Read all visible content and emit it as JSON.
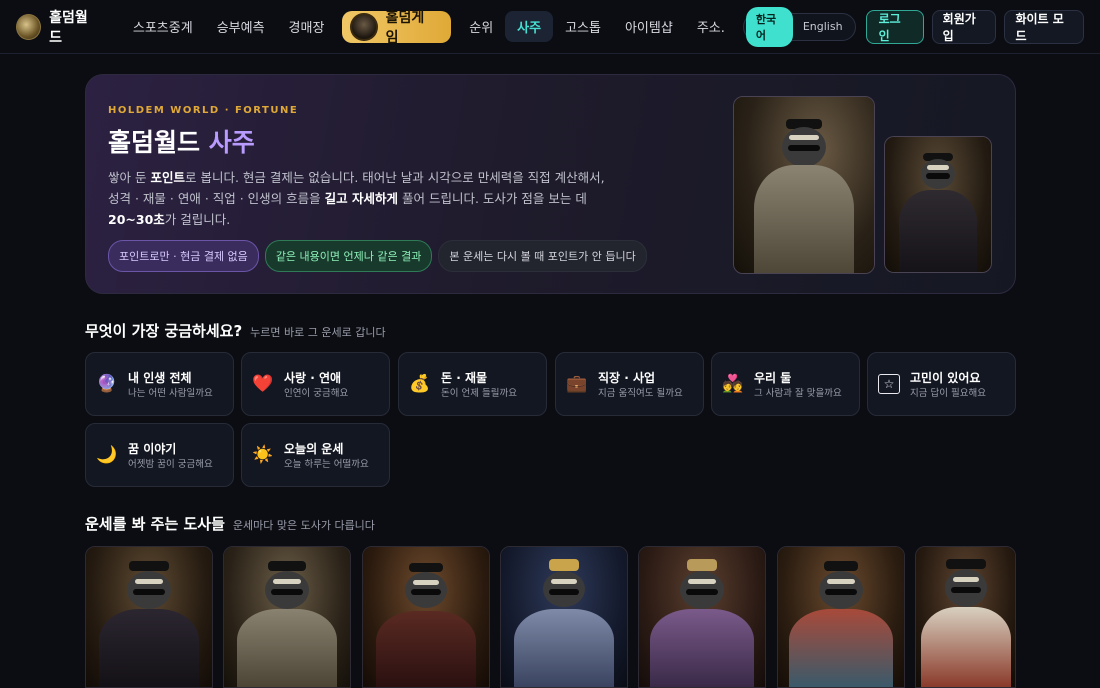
{
  "nav": {
    "brand": "홀덤월드",
    "items": [
      "스포츠중계",
      "승부예측",
      "경매장"
    ],
    "holdem_game": "홀덤게임",
    "items_right": [
      "순위",
      "사주",
      "고스톱",
      "아이템샵",
      "주소."
    ],
    "active": "사주",
    "lang": {
      "ko": "한국어",
      "en": "English"
    },
    "login": "로그인",
    "signup": "회원가입",
    "white_mode": "화이트 모드"
  },
  "hero": {
    "kicker": "HOLDEM WORLD · FORTUNE",
    "title_main": "홀덤월드",
    "title_accent": "사주",
    "desc": {
      "l1_a": "쌓아 둔 ",
      "l1_b": "포인트",
      "l1_c": "로 봅니다. 현금 결제는 없습니다. 태어난 날과 시각으로 만세력을 직접 계산해서,",
      "l2_a": "성격 · 재물 · 연애 · 직업 · 인생의 흐름을 ",
      "l2_b": "길고 자세하게",
      "l2_c": " 풀어 드립니다. 도사가 점을 보는 데",
      "l3_a": "20~30초",
      "l3_b": "가 걸립니다."
    },
    "pills": [
      "포인트로만 · 현금 결제 없음",
      "같은 내용이면 언제나 같은 결과",
      "본 운세는 다시 볼 때 포인트가 안 듭니다"
    ]
  },
  "categories_section": {
    "title": "무엇이 가장 궁금하세요?",
    "sub": "누르면 바로 그 운세로 갑니다",
    "items": [
      {
        "icon": "🔮",
        "icon_name": "crystal-ball-icon",
        "title": "내 인생 전체",
        "sub": "나는 어떤 사람일까요"
      },
      {
        "icon": "❤️",
        "icon_name": "heart-icon",
        "title": "사랑 · 연애",
        "sub": "인연이 궁금해요"
      },
      {
        "icon": "💰",
        "icon_name": "money-bag-icon",
        "title": "돈 · 재물",
        "sub": "돈이 언제 들릴까요"
      },
      {
        "icon": "💼",
        "icon_name": "briefcase-icon",
        "title": "직장 · 사업",
        "sub": "지금 움직여도 될까요"
      },
      {
        "icon": "💑",
        "icon_name": "couple-icon",
        "title": "우리 둘",
        "sub": "그 사람과 잘 맞을까요"
      },
      {
        "icon": "☆",
        "icon_name": "star-box-icon",
        "title": "고민이 있어요",
        "sub": "지금 답이 필요해요"
      },
      {
        "icon": "🌙",
        "icon_name": "crescent-moon-icon",
        "title": "꿈 이야기",
        "sub": "어젯밤 꿈이 궁금해요"
      },
      {
        "icon": "☀️",
        "icon_name": "sun-icon",
        "title": "오늘의 운세",
        "sub": "오늘 하루는 어떨까요"
      }
    ]
  },
  "tellers_section": {
    "title": "운세를 봐 주는 도사들",
    "sub": "운세마다 맞은 도사가 다릅니다"
  },
  "colors": {
    "accent_teal": "#46e0d2",
    "accent_gold": "#e0a937",
    "accent_purple": "#b99bff"
  }
}
